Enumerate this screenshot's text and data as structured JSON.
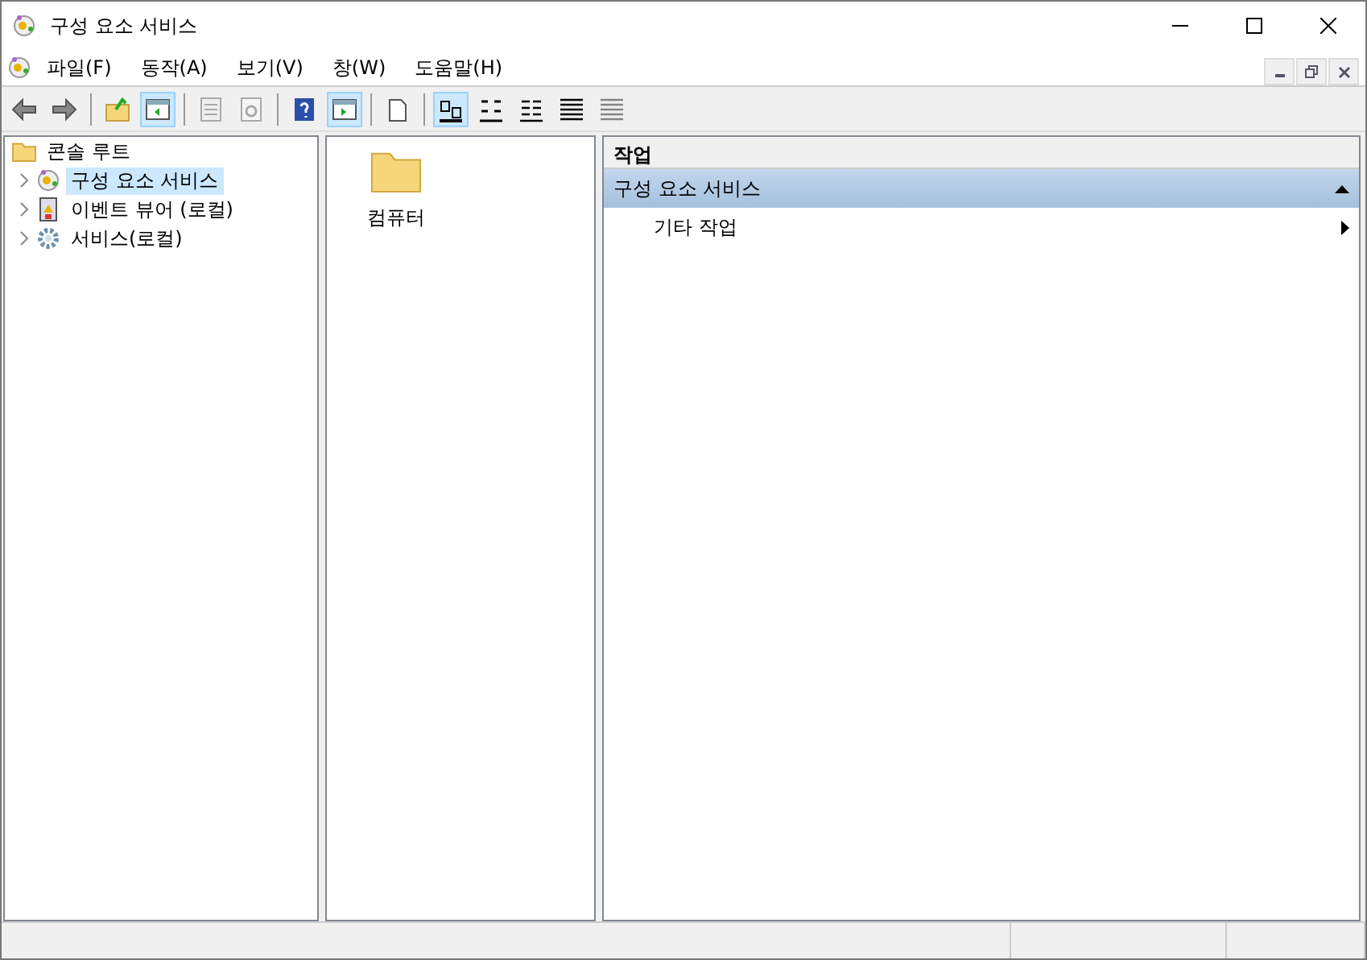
{
  "window": {
    "title": "구성 요소 서비스"
  },
  "menu": [
    "파일(F)",
    "동작(A)",
    "보기(V)",
    "창(W)",
    "도움말(H)"
  ],
  "toolbar": [
    {
      "kind": "back",
      "pressed": false,
      "disabled": false
    },
    {
      "kind": "forward",
      "pressed": false,
      "disabled": false
    },
    {
      "kind": "separator"
    },
    {
      "kind": "up-folder",
      "pressed": false,
      "disabled": false
    },
    {
      "kind": "tree-pane",
      "pressed": true,
      "disabled": false
    },
    {
      "kind": "separator"
    },
    {
      "kind": "export",
      "pressed": false,
      "disabled": true
    },
    {
      "kind": "refresh",
      "pressed": false,
      "disabled": true
    },
    {
      "kind": "separator"
    },
    {
      "kind": "help",
      "pressed": false,
      "disabled": false
    },
    {
      "kind": "action-pane",
      "pressed": true,
      "disabled": false
    },
    {
      "kind": "separator"
    },
    {
      "kind": "new-window",
      "pressed": false,
      "disabled": false
    },
    {
      "kind": "separator"
    },
    {
      "kind": "large-icons",
      "pressed": true,
      "disabled": false
    },
    {
      "kind": "small-icons",
      "pressed": false,
      "disabled": false
    },
    {
      "kind": "list",
      "pressed": false,
      "disabled": false
    },
    {
      "kind": "details",
      "pressed": false,
      "disabled": false
    },
    {
      "kind": "details",
      "pressed": false,
      "disabled": true
    }
  ],
  "tree": {
    "root": {
      "label": "콘솔 루트"
    },
    "items": [
      {
        "label": "구성 요소 서비스",
        "selected": true,
        "expanded": false
      },
      {
        "label": "이벤트 뷰어 (로컬)",
        "selected": false,
        "expanded": false
      },
      {
        "label": "서비스(로컬)",
        "selected": false,
        "expanded": false
      }
    ]
  },
  "content": {
    "items": [
      {
        "label": "컴퓨터"
      }
    ]
  },
  "actions": {
    "header": "작업",
    "sections": [
      {
        "title": "구성 요소 서비스",
        "expanded": true,
        "items": [
          {
            "label": "기타 작업"
          }
        ]
      }
    ]
  }
}
